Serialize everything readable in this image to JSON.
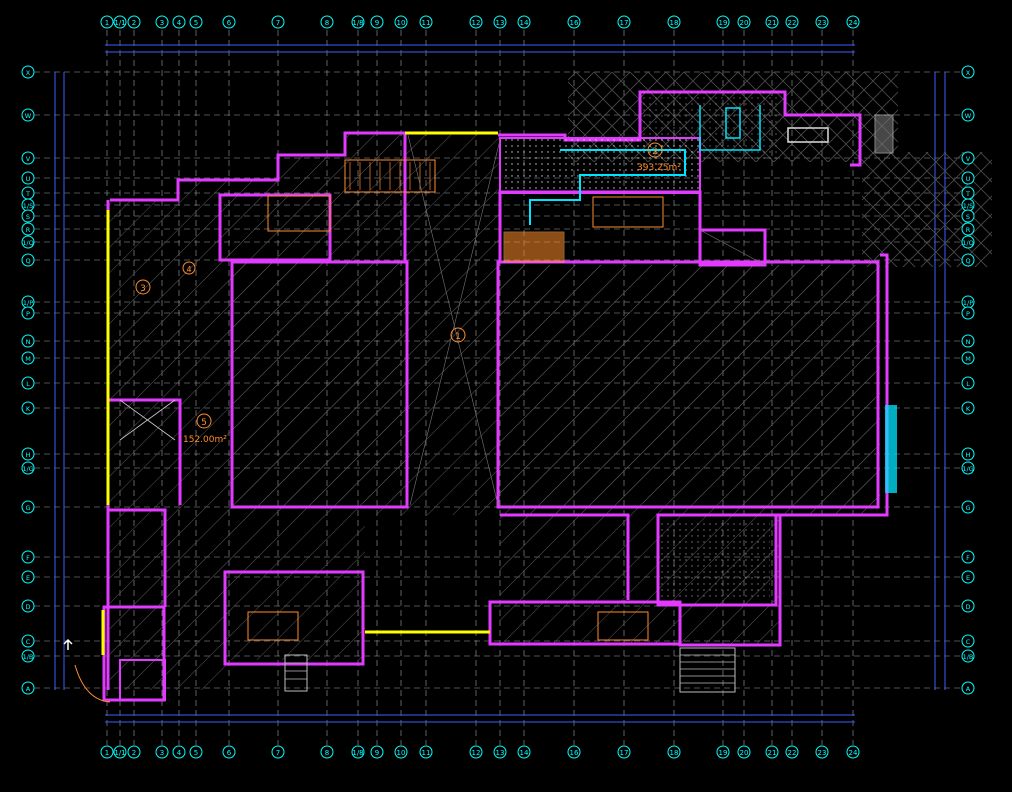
{
  "colors": {
    "background": "#000000",
    "wall": "#e23bff",
    "grid": "#9aa0a6",
    "axis": "#00ffff",
    "dim": "#3b5bff",
    "yellow": "#ffff00",
    "hatch": "#6a6a6a",
    "orange": "#ff8c2a",
    "green": "#33ff66",
    "red": "#ff3030",
    "cyan": "#00e5ff"
  },
  "column_axes": [
    "1",
    "1/1",
    "2",
    "3",
    "4",
    "5",
    "6",
    "7",
    "8",
    "1/8",
    "9",
    "10",
    "11",
    "12",
    "13",
    "14",
    "16",
    "17",
    "18",
    "19",
    "20",
    "21",
    "22",
    "23",
    "24"
  ],
  "row_axes": [
    "X",
    "W",
    "V",
    "U",
    "T",
    "1/S",
    "S",
    "R",
    "1/Q",
    "Q",
    "1/P",
    "P",
    "N",
    "M",
    "L",
    "K",
    "H",
    "1/G",
    "G",
    "F",
    "E",
    "D",
    "C",
    "1/B",
    "A"
  ],
  "zone_labels": [
    {
      "text": "1"
    },
    {
      "text": "2"
    },
    {
      "text": "3"
    },
    {
      "text": "4"
    },
    {
      "text": "5"
    }
  ],
  "area_labels": [
    "393.25m²",
    "152.00m²"
  ]
}
